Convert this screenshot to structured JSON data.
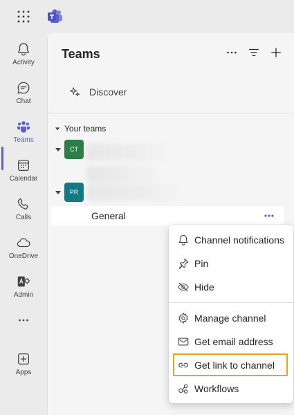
{
  "app": {
    "brand_color": "#5b5fc7"
  },
  "rail": {
    "items": [
      {
        "label": "Activity",
        "icon": "bell-icon"
      },
      {
        "label": "Chat",
        "icon": "chat-icon"
      },
      {
        "label": "Teams",
        "icon": "teams-icon",
        "active": true
      },
      {
        "label": "Calendar",
        "icon": "calendar-icon"
      },
      {
        "label": "Calls",
        "icon": "phone-icon"
      },
      {
        "label": "OneDrive",
        "icon": "cloud-icon"
      },
      {
        "label": "Admin",
        "icon": "admin-icon"
      },
      {
        "label": "",
        "icon": "more-icon"
      },
      {
        "label": "Apps",
        "icon": "apps-add-icon"
      }
    ]
  },
  "panel": {
    "title": "Teams",
    "discover_label": "Discover",
    "your_teams_label": "Your teams",
    "teams": [
      {
        "initials": "CT",
        "color": "#2d7d46"
      },
      {
        "initials": "PR",
        "color": "#127a82"
      }
    ],
    "channel": {
      "name": "General"
    }
  },
  "menu": {
    "items": [
      {
        "label": "Channel notifications",
        "icon": "bell-icon"
      },
      {
        "label": "Pin",
        "icon": "pin-icon"
      },
      {
        "label": "Hide",
        "icon": "eye-off-icon"
      },
      {
        "label": "Manage channel",
        "icon": "gear-icon"
      },
      {
        "label": "Get email address",
        "icon": "mail-icon"
      },
      {
        "label": "Get link to channel",
        "icon": "link-icon",
        "highlighted": true
      },
      {
        "label": "Workflows",
        "icon": "workflows-icon"
      }
    ],
    "highlight_color": "#e8a317"
  }
}
